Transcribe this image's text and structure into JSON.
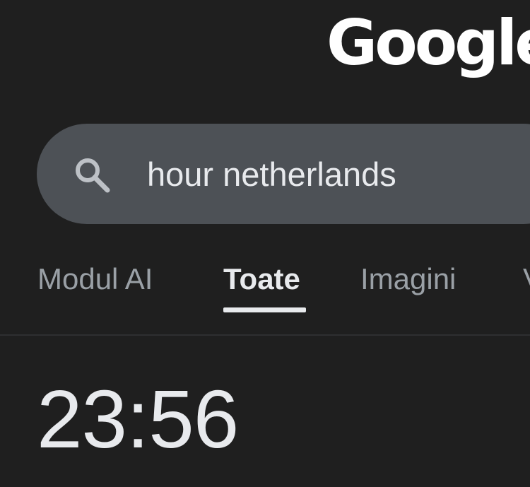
{
  "header": {
    "logo_text": "Google"
  },
  "search": {
    "query": "hour netherlands",
    "icon": "search-icon"
  },
  "tabs": [
    {
      "label": "Modul AI",
      "active": false
    },
    {
      "label": "Toate",
      "active": true
    },
    {
      "label": "Imagini",
      "active": false
    },
    {
      "label": "V",
      "active": false
    }
  ],
  "result": {
    "time": "23:56"
  },
  "colors": {
    "background": "#1f1f1f",
    "searchbar": "#4d5156",
    "text_primary": "#e8eaed",
    "text_secondary": "#9aa0a6"
  }
}
